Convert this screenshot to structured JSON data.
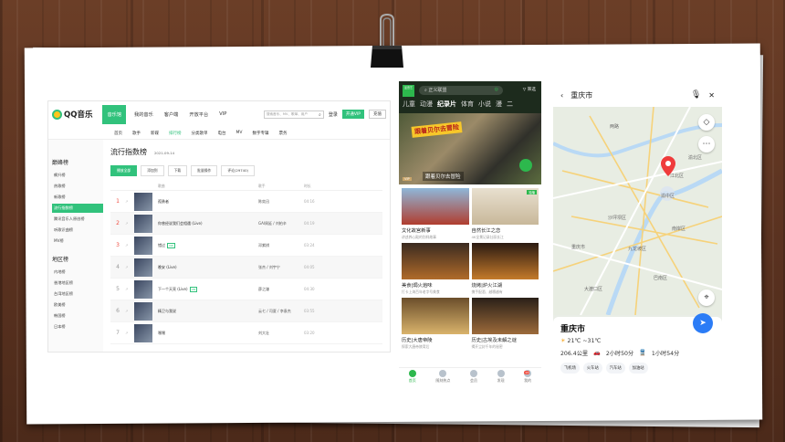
{
  "qq": {
    "brand": "QQ音乐",
    "nav": [
      "音乐馆",
      "我的音乐",
      "客户端",
      "开放平台",
      "VIP"
    ],
    "search_placeholder": "搜索音乐、MV、歌单、用户",
    "login": "登录",
    "open_vip": "开通VIP",
    "recharge": "充值",
    "subnav": [
      "首页",
      "歌手",
      "新碟",
      "排行榜",
      "分类歌单",
      "电台",
      "MV",
      "数字专辑",
      "票务"
    ],
    "side": {
      "h1": "巅峰榜",
      "items1": [
        "飙升榜",
        "热歌榜",
        "新歌榜",
        "流行指数榜",
        "腾讯音乐人原创榜",
        "听歌识曲榜",
        "MV榜"
      ],
      "h2": "地区榜",
      "items2": [
        "内地榜",
        "香港地区榜",
        "台湾地区榜",
        "欧美榜",
        "韩国榜",
        "日本榜"
      ]
    },
    "title": "流行指数榜",
    "date": "2021-09-14",
    "tools": [
      "播放全部",
      "添加到",
      "下载",
      "批量操作",
      "评论(29740)"
    ],
    "cols": [
      "歌曲",
      "歌手",
      "时长"
    ],
    "rows": [
      {
        "rank": "1",
        "song": "孤勇者",
        "singer": "陈奕迅",
        "dur": "04:16",
        "tag": ""
      },
      {
        "rank": "2",
        "song": "你曾经说我们会相遇 (Live)",
        "singer": "GAI周延 / 刘柏辛",
        "dur": "04:19",
        "tag": ""
      },
      {
        "rank": "3",
        "song": "错过",
        "singer": "邓紫棋",
        "dur": "03:24",
        "tag": "VIP"
      },
      {
        "rank": "4",
        "song": "晚安 (Live)",
        "singer": "张杰 / 刘宇宁",
        "dur": "04:05",
        "tag": ""
      },
      {
        "rank": "5",
        "song": "下一个天亮 (Live)",
        "singer": "薛之谦",
        "dur": "04:30",
        "tag": "VIP"
      },
      {
        "rank": "6",
        "song": "精卫与我说",
        "singer": "云七 / 司夏 / 李袁杰",
        "dur": "03:55",
        "tag": ""
      },
      {
        "rank": "7",
        "song": "嘿嘿",
        "singer": "刘大壮",
        "dur": "03:20",
        "tag": ""
      }
    ]
  },
  "video": {
    "logo": "爱奇艺",
    "search": "正义联盟",
    "filter": "筛选",
    "tabs": [
      "儿童",
      "动漫",
      "纪录片",
      "体育",
      "小说",
      "漫",
      "二"
    ],
    "hero_badge": "跟着贝尔去冒险",
    "hero_caption": "跟着贝尔去冒险",
    "vip": "VIP",
    "cards": [
      {
        "title": "文化故宫新事",
        "sub": "讲述养心殿的别样故事",
        "label": ""
      },
      {
        "title": "自然长江之恋",
        "sub": "4K全景记录壮丽长江",
        "label": "独播"
      },
      {
        "title": "美食|焗火焰味",
        "sub": "打卡上海百年老字号美食",
        "label": ""
      },
      {
        "title": "烧烤|炉火江湖",
        "sub": "携手配酒、越嚼越有",
        "label": ""
      },
      {
        "title": "历史|大唐帝陵",
        "sub": "探索大唐帝陵背后",
        "label": ""
      },
      {
        "title": "历史|古埃及未解之谜",
        "sub": "揭开尘封千年的秘密",
        "label": ""
      }
    ],
    "nav": [
      "首页",
      "随刻热点",
      "会员",
      "发现",
      "我的"
    ],
    "badge": "13"
  },
  "map": {
    "query": "重庆市",
    "labels": [
      "两路",
      "江北区",
      "渝北区",
      "巴南区",
      "九龙坡区",
      "沙坪坝区",
      "大渡口区",
      "南岸区",
      "渝中区",
      "重庆市"
    ],
    "city": "重庆市",
    "temp": "21℃ ~31℃",
    "distance": "206.4公里",
    "drive": "2小时50分",
    "time2": "1小时54分",
    "buttons": [
      "飞机场",
      "火车站",
      "汽车站",
      "加油站"
    ]
  }
}
